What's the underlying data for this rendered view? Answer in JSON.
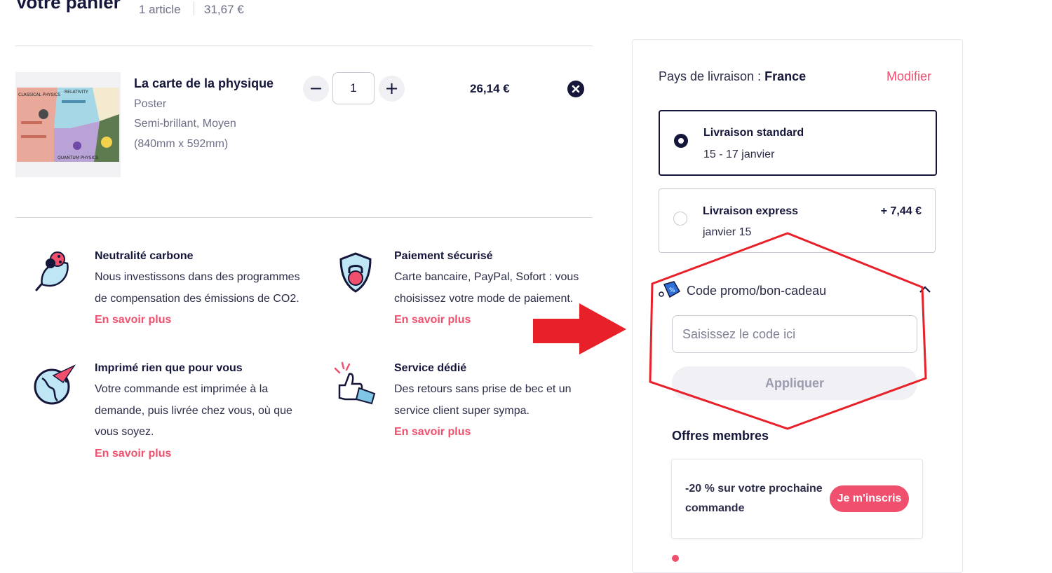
{
  "cart": {
    "title": "Votre panier",
    "item_count": "1 article",
    "total": "31,67 €"
  },
  "product": {
    "title": "La carte de la physique",
    "type": "Poster",
    "finish": "Semi-brillant, Moyen",
    "dimensions": "(840mm x 592mm)",
    "quantity": "1",
    "price": "26,14 €",
    "thumb_labels": [
      "CLASSICAL PHYSICS",
      "RELATIVITY",
      "QUANTUM PHYSICS"
    ]
  },
  "features": [
    {
      "title": "Neutralité carbone",
      "lines": [
        "Nous investissons dans des programmes",
        "de compensation des émissions de CO2."
      ],
      "link": "En savoir plus"
    },
    {
      "title": "Paiement sécurisé",
      "lines": [
        "Carte bancaire, PayPal, Sofort : vous",
        "choisissez votre mode de paiement."
      ],
      "link": "En savoir plus"
    },
    {
      "title": "Imprimé rien que pour vous",
      "lines": [
        "Votre commande est imprimée à la",
        "demande, puis livrée chez vous, où que",
        "vous soyez."
      ],
      "link": "En savoir plus"
    },
    {
      "title": "Service dédié",
      "lines": [
        "Des retours sans prise de bec et un",
        "service client super sympa."
      ],
      "link": "En savoir plus"
    }
  ],
  "shipping": {
    "country_label": "Pays de livraison : ",
    "country": "France",
    "modify": "Modifier",
    "options": [
      {
        "name": "Livraison standard",
        "date": "15 - 17 janvier",
        "extra": "",
        "selected": true
      },
      {
        "name": "Livraison express",
        "date": "janvier 15",
        "extra": "+ 7,44 €",
        "selected": false
      }
    ]
  },
  "promo": {
    "label": "Code promo/bon-cadeau",
    "placeholder": "Saisissez le code ici",
    "apply": "Appliquer"
  },
  "offers": {
    "title": "Offres membres",
    "text": "-20 % sur votre prochaine commande",
    "button": "Je m'inscris"
  },
  "colors": {
    "accent": "#f0506e",
    "navy": "#14163a",
    "annotation_red": "#e8202a"
  },
  "icons": [
    "minus-icon",
    "plus-icon",
    "close-icon",
    "leaf-ladybug-icon",
    "shield-lock-icon",
    "globe-plane-icon",
    "thumbs-up-icon",
    "promo-tag-icon",
    "chevron-up-icon"
  ]
}
